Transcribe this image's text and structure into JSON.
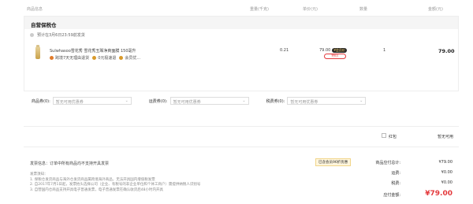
{
  "columns": {
    "product": "商品信息",
    "weight": "重量(千克)",
    "unit_price": "单价(元)",
    "qty": "数量",
    "amount": "金额(元)"
  },
  "order": {
    "title": "自营保税仓",
    "ship_note": "预计在3月6日23:59前发货",
    "item": {
      "name": "Sulwhasoo雪花秀 雪花秀玉璨净爽面膜 150毫升",
      "tags": [
        "跨境7天无理由退货",
        "0元极速退",
        "会员优..."
      ],
      "weight": "0.21",
      "price": "79.00",
      "price_badge": "¥会员价",
      "vip_btn": "特价",
      "qty": "1",
      "amount": "79.00"
    }
  },
  "coupons": [
    {
      "label": "商品券(0):",
      "value": "暂无可用优惠券"
    },
    {
      "label": "运费券(0):",
      "value": "暂无可用优惠券"
    },
    {
      "label": "税费券(0):",
      "value": "暂无可用优惠券"
    }
  ],
  "gift_wrap": {
    "label": "红包",
    "value": "暂无可用"
  },
  "invoice": "发票信息：订单中所有商品均不支持开具发票",
  "notes": [
    "发票须知：",
    "1. 保税仓发货商品与海外仓发货商品属跨境海外商品，无法开具国内增值税发票",
    "2. 自2017年7月1日起，发票抬头选择公司（企业、有税号的非企业单位和个体工商户）需提供纳税人识别号",
    "3. 自营国内仓商品支持开具电子普通发票，电子普通发票在确认收货后48小时内开具"
  ],
  "vip_chip": "已含会员96折优惠",
  "summary": {
    "goods_total_label": "商品应付总计:",
    "goods_total": "¥79.00",
    "shipping_label": "运费:",
    "shipping": "¥0.00",
    "tax_label": "税费:",
    "tax": "¥0.00",
    "due_label": "应付金额:",
    "due": "¥79.00"
  }
}
